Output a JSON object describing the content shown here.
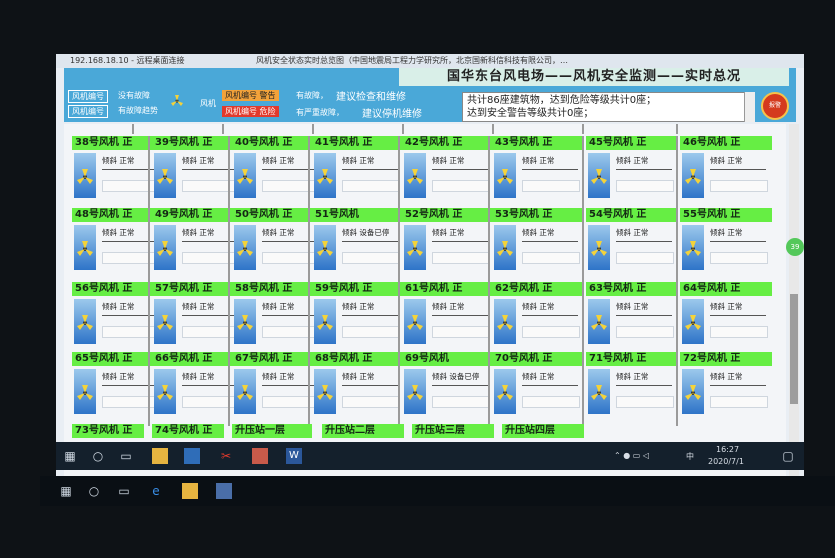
{
  "window": {
    "title_text": "192.168.18.10 - 远程桌面连接",
    "page_title": "风机安全状态实时总览图（中国地震局工程力学研究所，北京国新科信科技有限公司，…"
  },
  "header": {
    "title": "国华东台风电场——风机安全监测——实时总况",
    "legend": [
      {
        "box": "风机编号",
        "text": "没有故障",
        "color": "#4aa8d8"
      },
      {
        "box": "风机编号",
        "text": "有故障趋势",
        "color": "#4aa8d8"
      },
      {
        "box": "风机编号 警告",
        "text": "有故障，",
        "color": "#f2a23a"
      },
      {
        "box": "风机编号 危险",
        "text": "有严重故障，",
        "color": "#e23a2c"
      }
    ],
    "advice_1": "建议检查和维修",
    "advice_2": "建议停机维修",
    "fan_label": "风机",
    "stats_line_1": "共计86座建筑物，达到危险等级共计0座；",
    "stats_line_2": "达到安全警告等级共计0座；",
    "alarm_label": "报警"
  },
  "rows": [
    {
      "cards": [
        {
          "name": "38号风机 正",
          "status": "倾斜  正常"
        },
        {
          "name": "39号风机 正",
          "status": "倾斜  正常"
        },
        {
          "name": "40号风机 正",
          "status": "倾斜  正常"
        },
        {
          "name": "41号风机 正",
          "status": "倾斜  正常"
        },
        {
          "name": "42号风机 正",
          "status": "倾斜  正常"
        },
        {
          "name": "43号风机 正",
          "status": "倾斜  正常"
        },
        {
          "name": "45号风机 正",
          "status": "倾斜  正常"
        },
        {
          "name": "46号风机 正",
          "status": "倾斜  正常"
        }
      ]
    },
    {
      "cards": [
        {
          "name": "48号风机 正",
          "status": "倾斜  正常"
        },
        {
          "name": "49号风机 正",
          "status": "倾斜  正常"
        },
        {
          "name": "50号风机 正",
          "status": "倾斜  正常"
        },
        {
          "name": "51号风机",
          "status": "倾斜 设备已停"
        },
        {
          "name": "52号风机 正",
          "status": "倾斜  正常"
        },
        {
          "name": "53号风机 正",
          "status": "倾斜  正常"
        },
        {
          "name": "54号风机 正",
          "status": "倾斜  正常"
        },
        {
          "name": "55号风机 正",
          "status": "倾斜  正常"
        }
      ]
    },
    {
      "cards": [
        {
          "name": "56号风机 正",
          "status": "倾斜  正常"
        },
        {
          "name": "57号风机 正",
          "status": "倾斜  正常"
        },
        {
          "name": "58号风机 正",
          "status": "倾斜  正常"
        },
        {
          "name": "59号风机 正",
          "status": "倾斜  正常"
        },
        {
          "name": "61号风机 正",
          "status": "倾斜  正常"
        },
        {
          "name": "62号风机 正",
          "status": "倾斜  正常"
        },
        {
          "name": "63号风机 正",
          "status": "倾斜  正常"
        },
        {
          "name": "64号风机 正",
          "status": "倾斜  正常"
        }
      ]
    },
    {
      "cards": [
        {
          "name": "65号风机 正",
          "status": "倾斜  正常"
        },
        {
          "name": "66号风机 正",
          "status": "倾斜  正常"
        },
        {
          "name": "67号风机 正",
          "status": "倾斜  正常"
        },
        {
          "name": "68号风机 正",
          "status": "倾斜  正常"
        },
        {
          "name": "69号风机",
          "status": "倾斜 设备已停"
        },
        {
          "name": "70号风机 正",
          "status": "倾斜  正常"
        },
        {
          "name": "71号风机 正",
          "status": "倾斜  正常"
        },
        {
          "name": "72号风机 正",
          "status": "倾斜  正常"
        }
      ]
    }
  ],
  "bottom_buttons": [
    "73号风机 正",
    "74号风机 正",
    "升压站一层",
    "升压站二层",
    "升压站三层",
    "升压站四层"
  ],
  "taskbar": {
    "time": "16:27",
    "date": "2020/7/1",
    "ime": "中"
  },
  "side_badge": "39"
}
